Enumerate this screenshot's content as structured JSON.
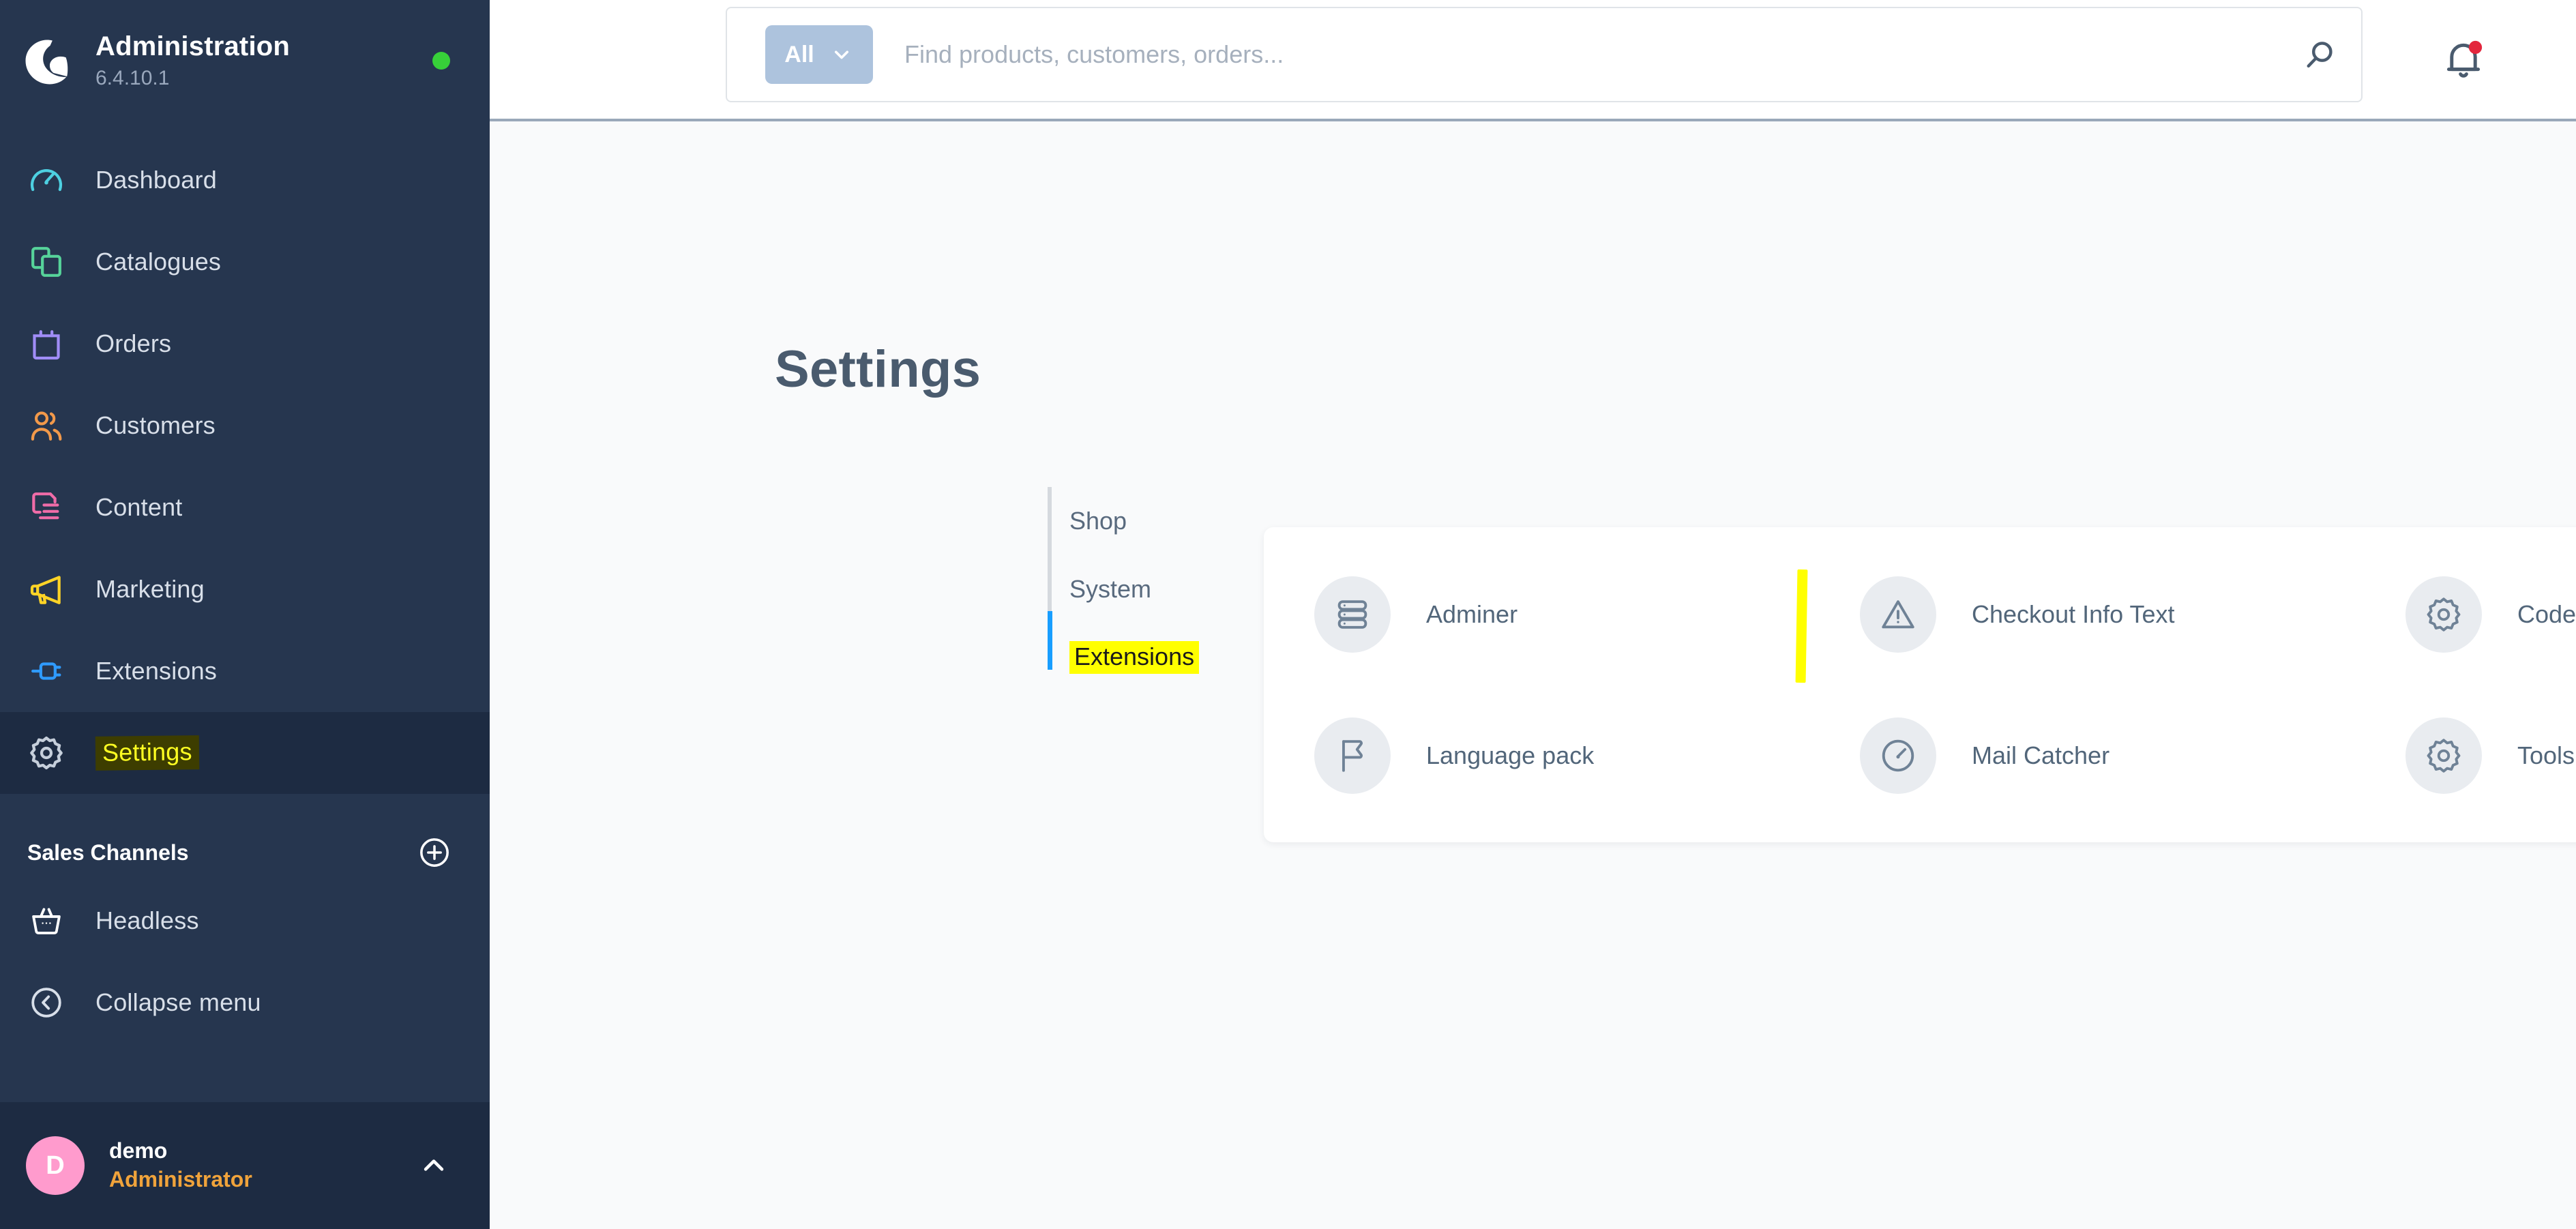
{
  "brand": {
    "title": "Administration",
    "version": "6.4.10.1",
    "logo_icon": "shopware-logo-icon",
    "status_icon": "status-online-dot",
    "status_color": "#37d039"
  },
  "sidebar": {
    "background_color": "#26364f",
    "items": [
      {
        "label": "Dashboard",
        "icon": "dashboard-gauge-icon",
        "color": "#4dd0e1",
        "active": false,
        "highlighted": false
      },
      {
        "label": "Catalogues",
        "icon": "catalogues-copy-icon",
        "color": "#56d39a",
        "active": false,
        "highlighted": false
      },
      {
        "label": "Orders",
        "icon": "orders-bag-icon",
        "color": "#a08df7",
        "active": false,
        "highlighted": false
      },
      {
        "label": "Customers",
        "icon": "customers-people-icon",
        "color": "#f2994a",
        "active": false,
        "highlighted": false
      },
      {
        "label": "Content",
        "icon": "content-document-icon",
        "color": "#f06ca8",
        "active": false,
        "highlighted": false
      },
      {
        "label": "Marketing",
        "icon": "marketing-megaphone-icon",
        "color": "#ffd426",
        "active": false,
        "highlighted": false
      },
      {
        "label": "Extensions",
        "icon": "extensions-plug-icon",
        "color": "#2f9bff",
        "active": false,
        "highlighted": false
      },
      {
        "label": "Settings",
        "icon": "settings-gear-icon",
        "color": "#c6cfdb",
        "active": true,
        "highlighted": true
      }
    ],
    "sales_channels": {
      "title": "Sales Channels",
      "add_icon": "plus-circle-icon",
      "items": [
        {
          "label": "Headless",
          "icon": "basket-icon"
        }
      ]
    },
    "collapse": {
      "label": "Collapse menu",
      "icon": "chevron-left-circle-icon"
    },
    "user": {
      "initial": "D",
      "name": "demo",
      "role": "Administrator",
      "avatar_color": "#ff9bcd",
      "role_color": "#f0a33b",
      "caret_icon": "chevron-up-icon"
    }
  },
  "topbar": {
    "search": {
      "scope_label": "All",
      "scope_caret_icon": "chevron-down-icon",
      "value": "",
      "placeholder": "Find products, customers, orders...",
      "submit_icon": "search-icon"
    },
    "notifications": {
      "icon": "bell-icon",
      "has_unread": true,
      "badge_color": "#e3263d"
    }
  },
  "page": {
    "title": "Settings",
    "subnav": [
      {
        "label": "Shop",
        "active": false,
        "highlighted": false
      },
      {
        "label": "System",
        "active": false,
        "highlighted": false
      },
      {
        "label": "Extensions",
        "active": true,
        "highlighted": true
      }
    ],
    "active_indicator_color": "#189eff",
    "extensions": [
      {
        "label": "Adminer",
        "icon": "database-icon"
      },
      {
        "label": "Checkout Info Text",
        "icon": "warning-triangle-icon"
      },
      {
        "label": "Code Editor",
        "icon": "gear-icon"
      },
      {
        "label": "Language pack",
        "icon": "flag-icon"
      },
      {
        "label": "Mail Catcher",
        "icon": "gauge-icon"
      },
      {
        "label": "Tools",
        "icon": "gear-icon"
      }
    ]
  },
  "annotations": {
    "highlight_color": "#ffff00",
    "marks": [
      {
        "target": "sidebar-item-settings",
        "type": "text-highlight"
      },
      {
        "target": "subnav-item-extensions",
        "type": "text-highlight"
      },
      {
        "target": "extensions-grid",
        "type": "vertical-bar"
      }
    ]
  }
}
